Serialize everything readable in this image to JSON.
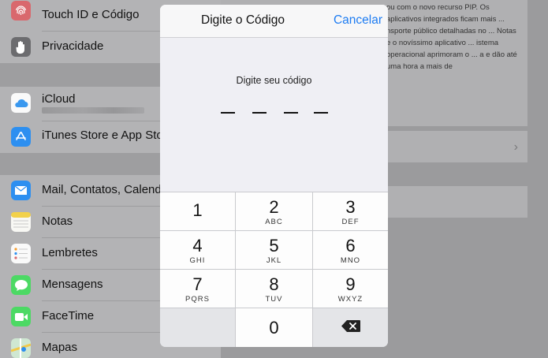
{
  "sidebar": {
    "items": [
      {
        "label": "Touch ID e Código",
        "icon": "fingerprint-icon",
        "color": "#d96a6f"
      },
      {
        "label": "Privacidade",
        "icon": "hand-icon",
        "color": "#6c6c6f"
      },
      {
        "label": "iCloud",
        "icon": "icloud-icon",
        "color": "#ffffff"
      },
      {
        "label": "iTunes Store e App Store",
        "icon": "app-store-icon",
        "color": "#2d8ff0"
      },
      {
        "label": "Mail, Contatos, Calendários",
        "icon": "mail-icon",
        "color": "#2d8ff0"
      },
      {
        "label": "Notas",
        "icon": "notes-icon",
        "color": "#f2d14a"
      },
      {
        "label": "Lembretes",
        "icon": "reminders-icon",
        "color": "#ffffff"
      },
      {
        "label": "Mensagens",
        "icon": "messages-icon",
        "color": "#4cd964"
      },
      {
        "label": "FaceTime",
        "icon": "facetime-icon",
        "color": "#4cd964"
      },
      {
        "label": "Mapas",
        "icon": "maps-icon",
        "color": "#9ad3a5"
      }
    ]
  },
  "detail": {
    "text": "ou com o novo recurso PIP. Os aplicativos integrados ficam mais ... nsporte público detalhadas no ... Notas e o novíssimo aplicativo ... istema operacional aprimoram o ... a e dão até uma hora a mais de"
  },
  "modal": {
    "title": "Digite o Código",
    "cancel_label": "Cancelar",
    "prompt": "Digite seu código",
    "accent_color": "#1d7cf2"
  },
  "keypad": {
    "keys": [
      {
        "digit": "1",
        "letters": ""
      },
      {
        "digit": "2",
        "letters": "ABC"
      },
      {
        "digit": "3",
        "letters": "DEF"
      },
      {
        "digit": "4",
        "letters": "GHI"
      },
      {
        "digit": "5",
        "letters": "JKL"
      },
      {
        "digit": "6",
        "letters": "MNO"
      },
      {
        "digit": "7",
        "letters": "PQRS"
      },
      {
        "digit": "8",
        "letters": "TUV"
      },
      {
        "digit": "9",
        "letters": "WXYZ"
      },
      {
        "digit": "0",
        "letters": ""
      }
    ],
    "delete_icon": "backspace-icon"
  }
}
